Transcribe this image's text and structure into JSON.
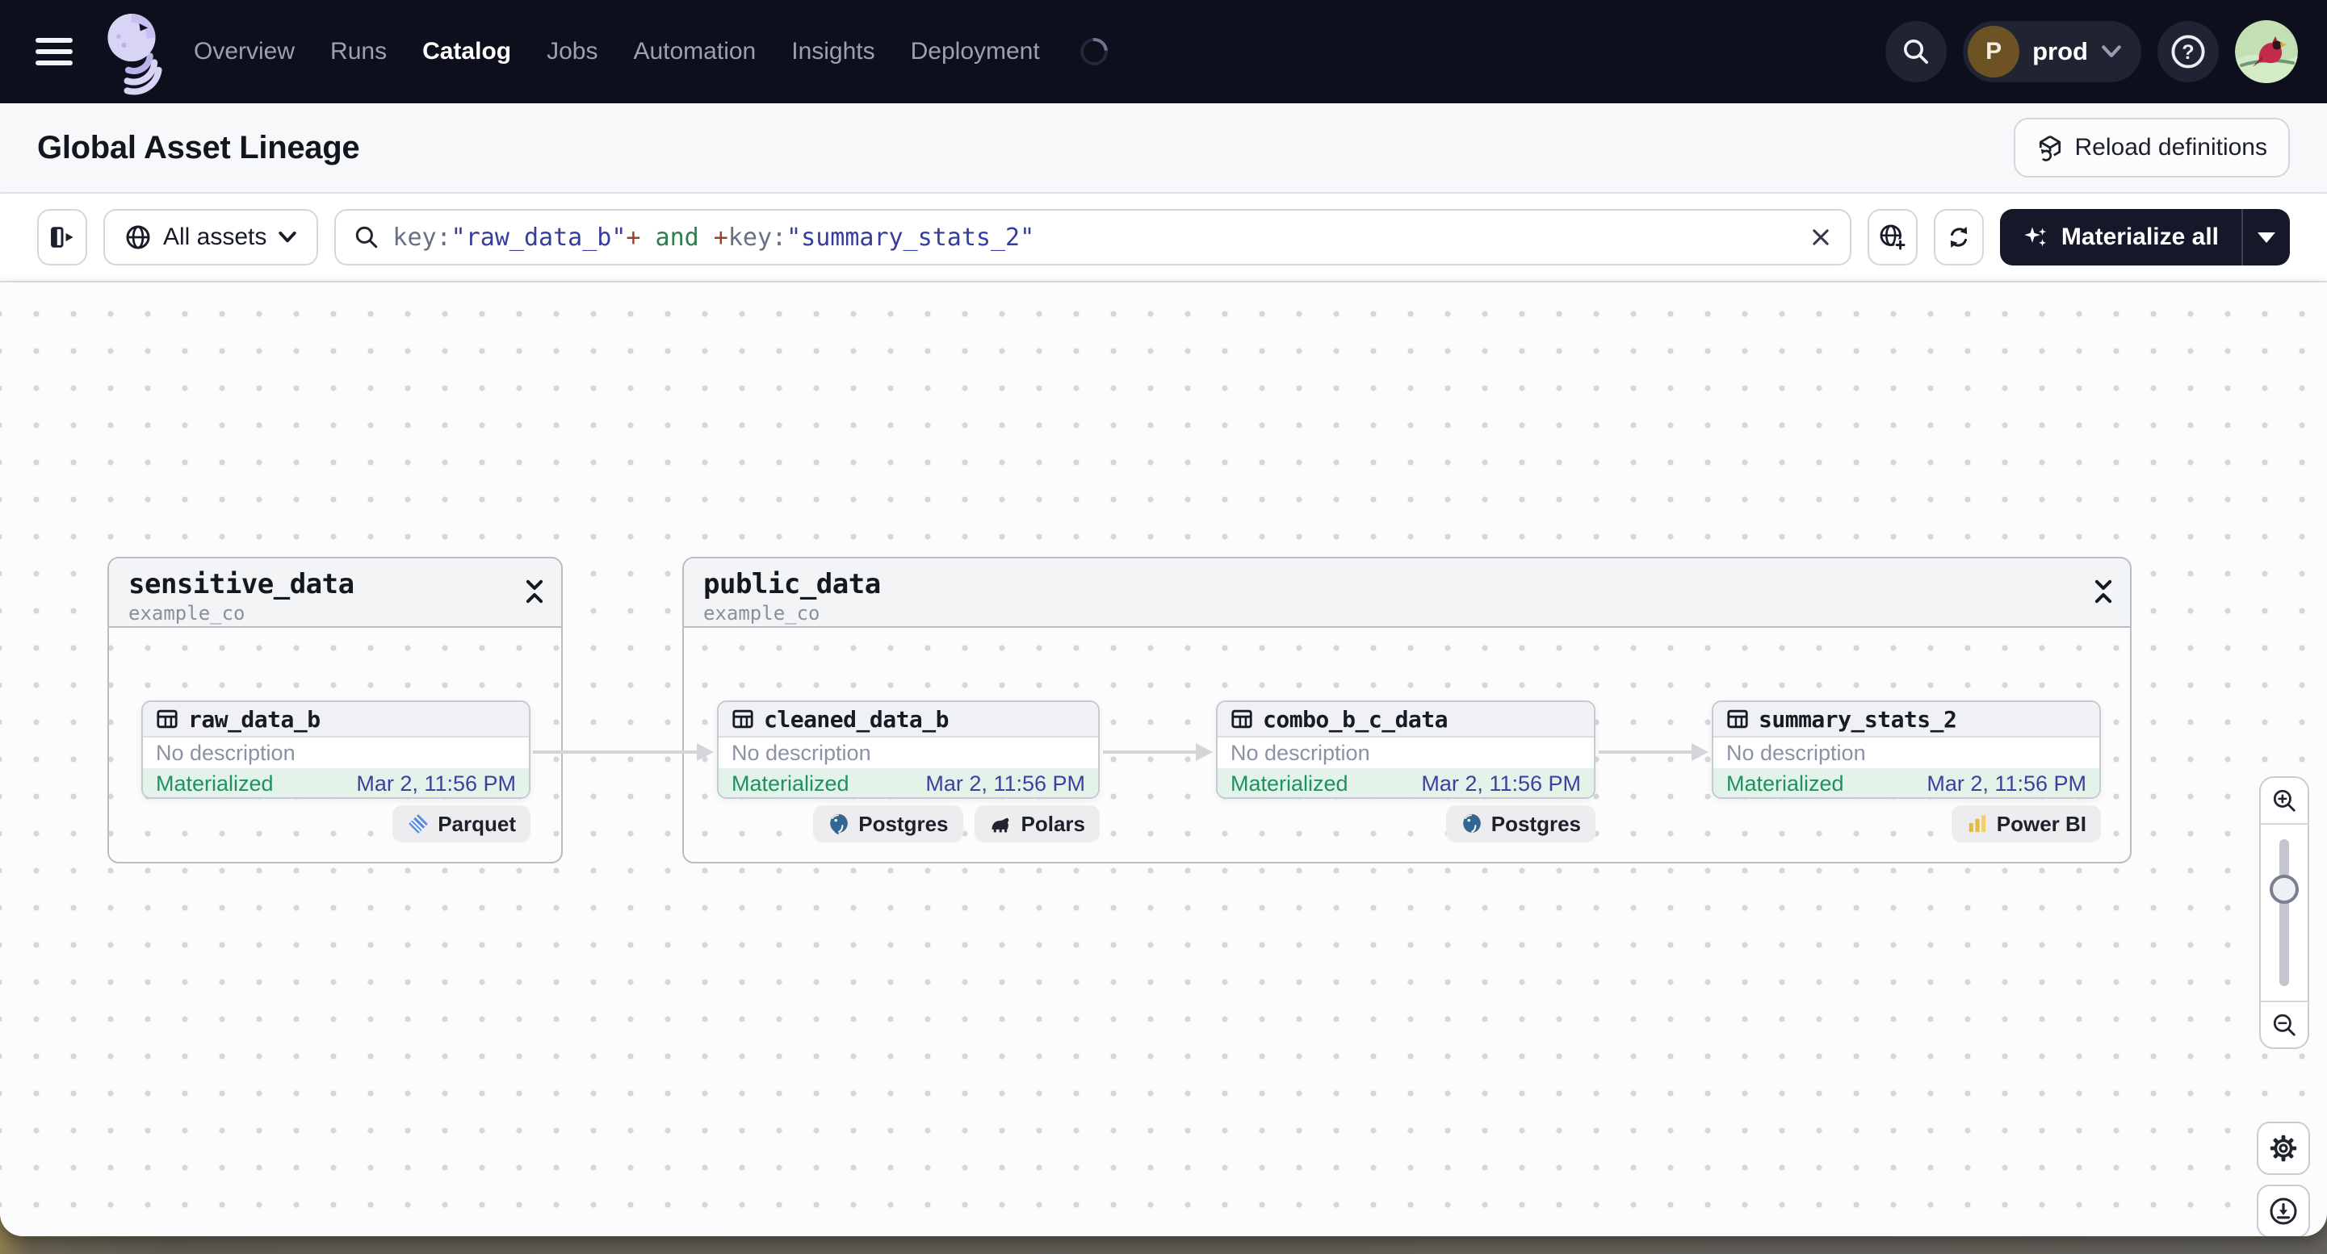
{
  "topnav": {
    "items": [
      {
        "label": "Overview",
        "active": false
      },
      {
        "label": "Runs",
        "active": false
      },
      {
        "label": "Catalog",
        "active": true
      },
      {
        "label": "Jobs",
        "active": false
      },
      {
        "label": "Automation",
        "active": false
      },
      {
        "label": "Insights",
        "active": false
      },
      {
        "label": "Deployment",
        "active": false
      }
    ],
    "deployment_switcher": {
      "initial": "P",
      "label": "prod"
    },
    "help_glyph": "?"
  },
  "header": {
    "title": "Global Asset Lineage",
    "reload_button_label": "Reload definitions"
  },
  "toolbar": {
    "scope_button_label": "All assets",
    "materialize_button_label": "Materialize all",
    "query_segments": [
      {
        "text": "key:",
        "type": "key"
      },
      {
        "text": "\"raw_data_b\"",
        "type": "value"
      },
      {
        "text": "+",
        "type": "operator"
      },
      {
        "text": " and ",
        "type": "keyword"
      },
      {
        "text": "+",
        "type": "operator"
      },
      {
        "text": "key:",
        "type": "key"
      },
      {
        "text": "\"summary_stats_2\"",
        "type": "value"
      }
    ]
  },
  "graph": {
    "groups": [
      {
        "name": "sensitive_data",
        "repository": "example_co",
        "assets": [
          {
            "name": "raw_data_b",
            "description": "No description",
            "status": "Materialized",
            "timestamp": "Mar 2, 11:56 PM",
            "badges": [
              {
                "label": "Parquet",
                "icon": "parquet-icon"
              }
            ]
          }
        ]
      },
      {
        "name": "public_data",
        "repository": "example_co",
        "assets": [
          {
            "name": "cleaned_data_b",
            "description": "No description",
            "status": "Materialized",
            "timestamp": "Mar 2, 11:56 PM",
            "badges": [
              {
                "label": "Postgres",
                "icon": "postgres-icon"
              },
              {
                "label": "Polars",
                "icon": "polars-icon"
              }
            ]
          },
          {
            "name": "combo_b_c_data",
            "description": "No description",
            "status": "Materialized",
            "timestamp": "Mar 2, 11:56 PM",
            "badges": [
              {
                "label": "Postgres",
                "icon": "postgres-icon"
              }
            ]
          },
          {
            "name": "summary_stats_2",
            "description": "No description",
            "status": "Materialized",
            "timestamp": "Mar 2, 11:56 PM",
            "badges": [
              {
                "label": "Power BI",
                "icon": "powerbi-icon"
              }
            ]
          }
        ]
      }
    ]
  },
  "colors": {
    "nav_background": "#0d0f1c",
    "status_green": "#1d9160",
    "status_background": "#e4f3ea",
    "timestamp_blue": "#3a41a0",
    "query_key": "#687083",
    "query_value": "#363d9b",
    "query_operator": "#9c3d2e",
    "query_keyword": "#2e7d4f",
    "edge_gray": "#d4d5d9",
    "brand_lavender": "#d8d4f6"
  }
}
